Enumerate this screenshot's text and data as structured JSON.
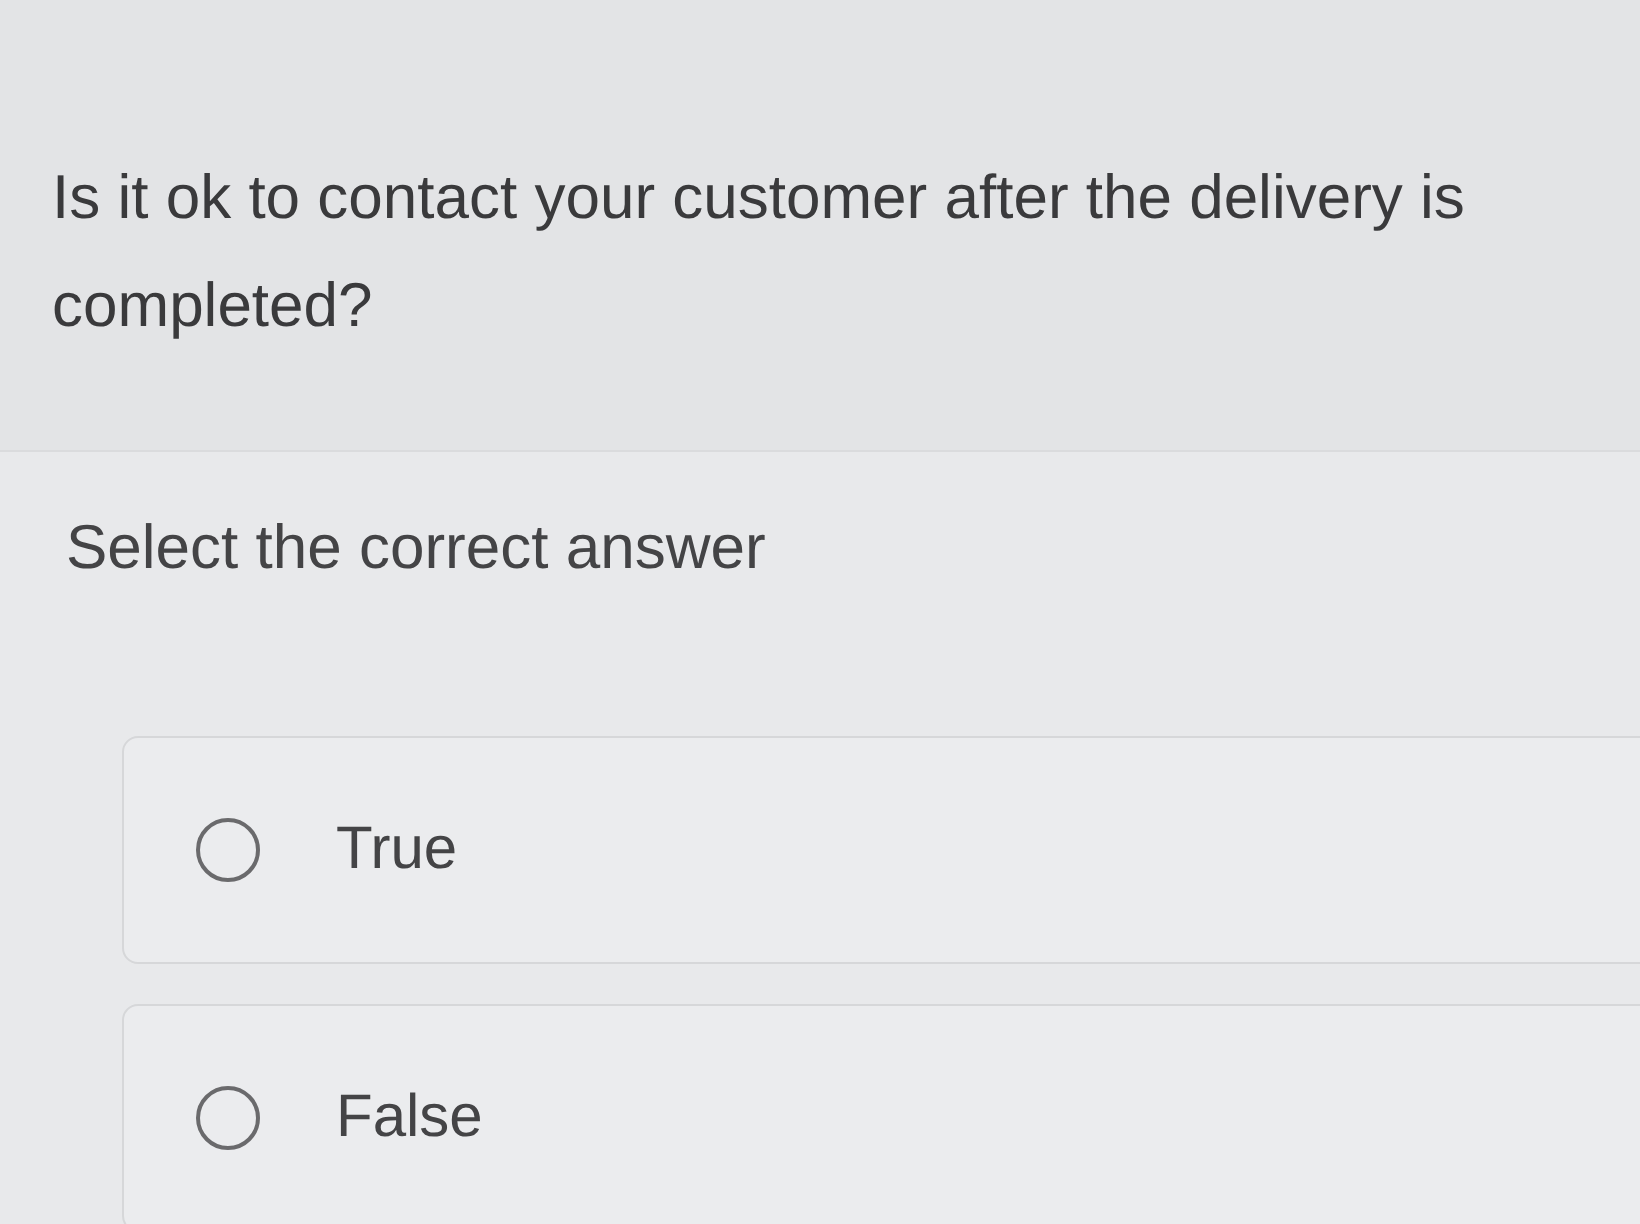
{
  "question": {
    "text": "Is it ok to contact your customer after the delivery is completed?"
  },
  "instruction": "Select the correct answer",
  "options": [
    {
      "label": "True",
      "selected": false
    },
    {
      "label": "False",
      "selected": false
    }
  ]
}
